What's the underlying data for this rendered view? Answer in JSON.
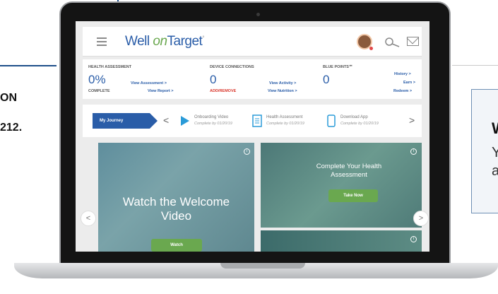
{
  "background_slide": {
    "text_line1": "ON",
    "text_line2": "212.",
    "callout_heading": "W",
    "callout_line1": "Y",
    "callout_line2": "a"
  },
  "app": {
    "logo_prefix": "Well ",
    "logo_on": "on",
    "logo_suffix": "Target",
    "logo_mark": "°"
  },
  "stats": {
    "health_title": "HEALTH ASSESSMENT",
    "health_value": "0%",
    "health_sub": "COMPLETE",
    "view_assessment": "View Assessment >",
    "view_report": "View Report >",
    "device_title": "DEVICE CONNECTIONS",
    "device_value": "0",
    "add_remove": "ADD/REMOVE",
    "view_activity": "View Activity >",
    "view_nutrition": "View Nutrition >",
    "blue_title": "BLUE POINTS℠",
    "blue_value": "0",
    "history": "History >",
    "earn": "Earn >",
    "redeem": "Redeem >"
  },
  "journey": {
    "label": "My Journey",
    "prev": "<",
    "next": ">",
    "steps": [
      {
        "title": "Onboarding Video",
        "sub": "Complete by 01/20/19"
      },
      {
        "title": "Health Assessment",
        "sub": "Complete by 01/20/19"
      },
      {
        "title": "Download App",
        "sub": "Complete by 01/20/19"
      }
    ]
  },
  "cards": {
    "welcome_title_1": "Watch the Welcome",
    "welcome_title_2": "Video",
    "welcome_button": "Watch",
    "health_title_1": "Complete Your Health",
    "health_title_2": "Assessment",
    "health_button": "Take Now",
    "info": "i"
  },
  "carousel": {
    "prev": "<",
    "next": ">"
  },
  "colors": {
    "brand_blue": "#2a5da8",
    "accent_green": "#6aa84f",
    "alert_red": "#d9362b"
  }
}
